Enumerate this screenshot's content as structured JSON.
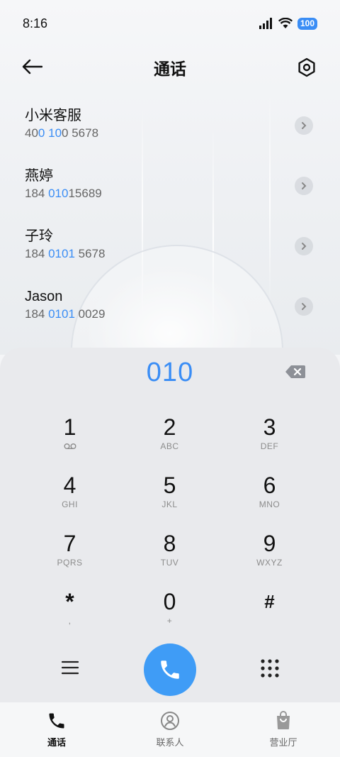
{
  "status_bar": {
    "time": "8:16",
    "battery": "100",
    "icons": [
      "signal-icon",
      "wifi-icon",
      "battery-icon"
    ]
  },
  "header": {
    "title": "通话",
    "back_icon": "arrow-left-icon",
    "settings_icon": "gear-hexagon-icon"
  },
  "contacts": [
    {
      "name": "小米客服",
      "number_parts": [
        "40",
        "0",
        " ",
        "10",
        "0 5678"
      ]
    },
    {
      "name": "燕婷",
      "number_parts": [
        "184 ",
        "010",
        "15689",
        "",
        ""
      ]
    },
    {
      "name": "子玲",
      "number_parts": [
        "184 ",
        "0101",
        " 5678",
        "",
        ""
      ]
    },
    {
      "name": "Jason",
      "number_parts": [
        "184 ",
        "0101",
        " 0029",
        "",
        ""
      ]
    }
  ],
  "dialer": {
    "input": "010",
    "keys": [
      {
        "digit": "1",
        "sub": ""
      },
      {
        "digit": "2",
        "sub": "ABC"
      },
      {
        "digit": "3",
        "sub": "DEF"
      },
      {
        "digit": "4",
        "sub": "GHI"
      },
      {
        "digit": "5",
        "sub": "JKL"
      },
      {
        "digit": "6",
        "sub": "MNO"
      },
      {
        "digit": "7",
        "sub": "PQRS"
      },
      {
        "digit": "8",
        "sub": "TUV"
      },
      {
        "digit": "9",
        "sub": "WXYZ"
      },
      {
        "digit": "*",
        "sub": ","
      },
      {
        "digit": "0",
        "sub": "+"
      },
      {
        "digit": "#",
        "sub": ""
      }
    ]
  },
  "bottom_nav": {
    "tabs": [
      {
        "label": "通话",
        "icon": "phone-icon",
        "active": true
      },
      {
        "label": "联系人",
        "icon": "contacts-icon",
        "active": false
      },
      {
        "label": "营业厅",
        "icon": "shopping-bag-icon",
        "active": false
      }
    ]
  },
  "colors": {
    "accent": "#3a8df5",
    "call_button": "#3f9cf6",
    "panel_bg": "#e9eaed"
  }
}
